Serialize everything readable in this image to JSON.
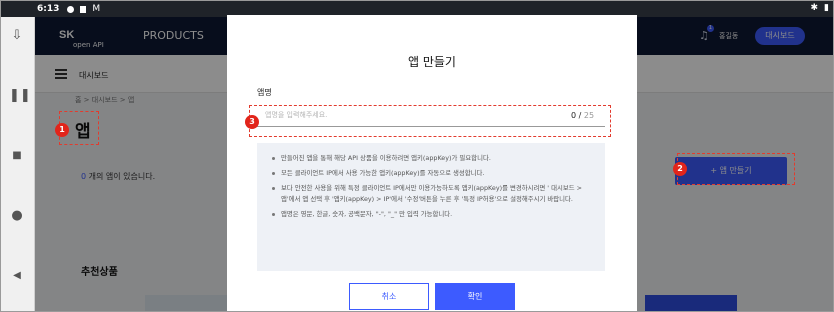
{
  "statusbar": {
    "time": "6:13",
    "icon_text": "M"
  },
  "header": {
    "logo": "SK",
    "logo_sub": "open API",
    "products": "PRODUCTS",
    "notification_count": "1",
    "username": "홍길동",
    "dashboard_button": "대시보드"
  },
  "subbar": {
    "title": "대시보드"
  },
  "page": {
    "breadcrumb": "홈 > 대시보드 > 앱",
    "title": "앱",
    "count": "0",
    "count_suffix": " 개의 앱이 있습니다.",
    "create_button": "+ 앱 만들기",
    "recommended": "추천상품"
  },
  "modal": {
    "title": "앱 만들기",
    "field_label": "앱명",
    "placeholder": "앱명을 입력해주세요.",
    "counter_current": "0 /",
    "counter_max": " 25",
    "info": [
      "만들어진 앱을 통해 해당 API 상품을 이용하려면 앱키(appKey)가 필요합니다.",
      "모든 클라이언트 IP에서 사용 가능한 앱키(appKey)를 자동으로 생성합니다.",
      "보다 안전한 사용을 위해 특정 클라이언트 IP에서만 이용가능하도록 앱키(appKey)를 변경하시려면 ' 대시보드 > 앱'에서 앱 선택 후 '앱키(appKey) > IP'에서 '수정'버튼을 누른 후 '특정 IP허용'으로 설정해주시기 바랍니다.",
      "앱명은 영문, 한글, 숫자, 공백문자, \"-\", \"_\" 만 입력 가능합니다."
    ],
    "cancel": "취소",
    "confirm": "확인"
  },
  "annotations": {
    "one": "1",
    "two": "2",
    "three": "3"
  },
  "colors": {
    "accent": "#3d5bff",
    "marker": "#e23b2e",
    "header_bg": "#0d1834"
  }
}
